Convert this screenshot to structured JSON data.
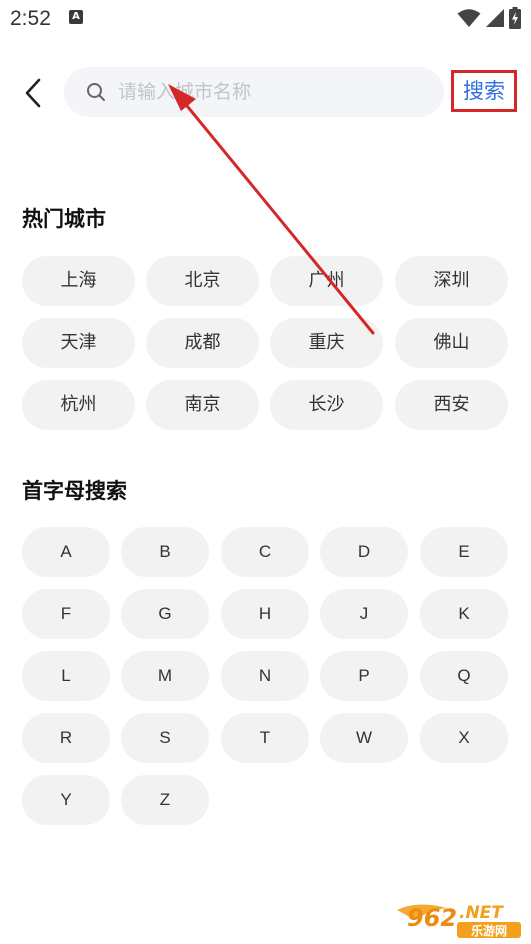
{
  "status_bar": {
    "time": "2:52",
    "notification_icon": "a-letter-icon",
    "icons": [
      "wifi-icon",
      "signal-icon",
      "battery-charging-icon"
    ]
  },
  "header": {
    "back_icon": "chevron-left-icon",
    "search_placeholder": "请输入城市名称",
    "search_value": "",
    "search_button_label": "搜索",
    "search_button_highlight_color": "#d42828",
    "search_button_text_color": "#2f6fde"
  },
  "hot_cities": {
    "title": "热门城市",
    "items": [
      "上海",
      "北京",
      "广州",
      "深圳",
      "天津",
      "成都",
      "重庆",
      "佛山",
      "杭州",
      "南京",
      "长沙",
      "西安"
    ]
  },
  "letter_search": {
    "title": "首字母搜索",
    "letters": [
      "A",
      "B",
      "C",
      "D",
      "E",
      "F",
      "G",
      "H",
      "J",
      "K",
      "L",
      "M",
      "N",
      "P",
      "Q",
      "R",
      "S",
      "T",
      "W",
      "X",
      "Y",
      "Z"
    ]
  },
  "annotation": {
    "color": "#d42828"
  },
  "watermark": {
    "brand_number": "962",
    "brand_suffix": ".NET",
    "brand_cn": "乐游网"
  }
}
